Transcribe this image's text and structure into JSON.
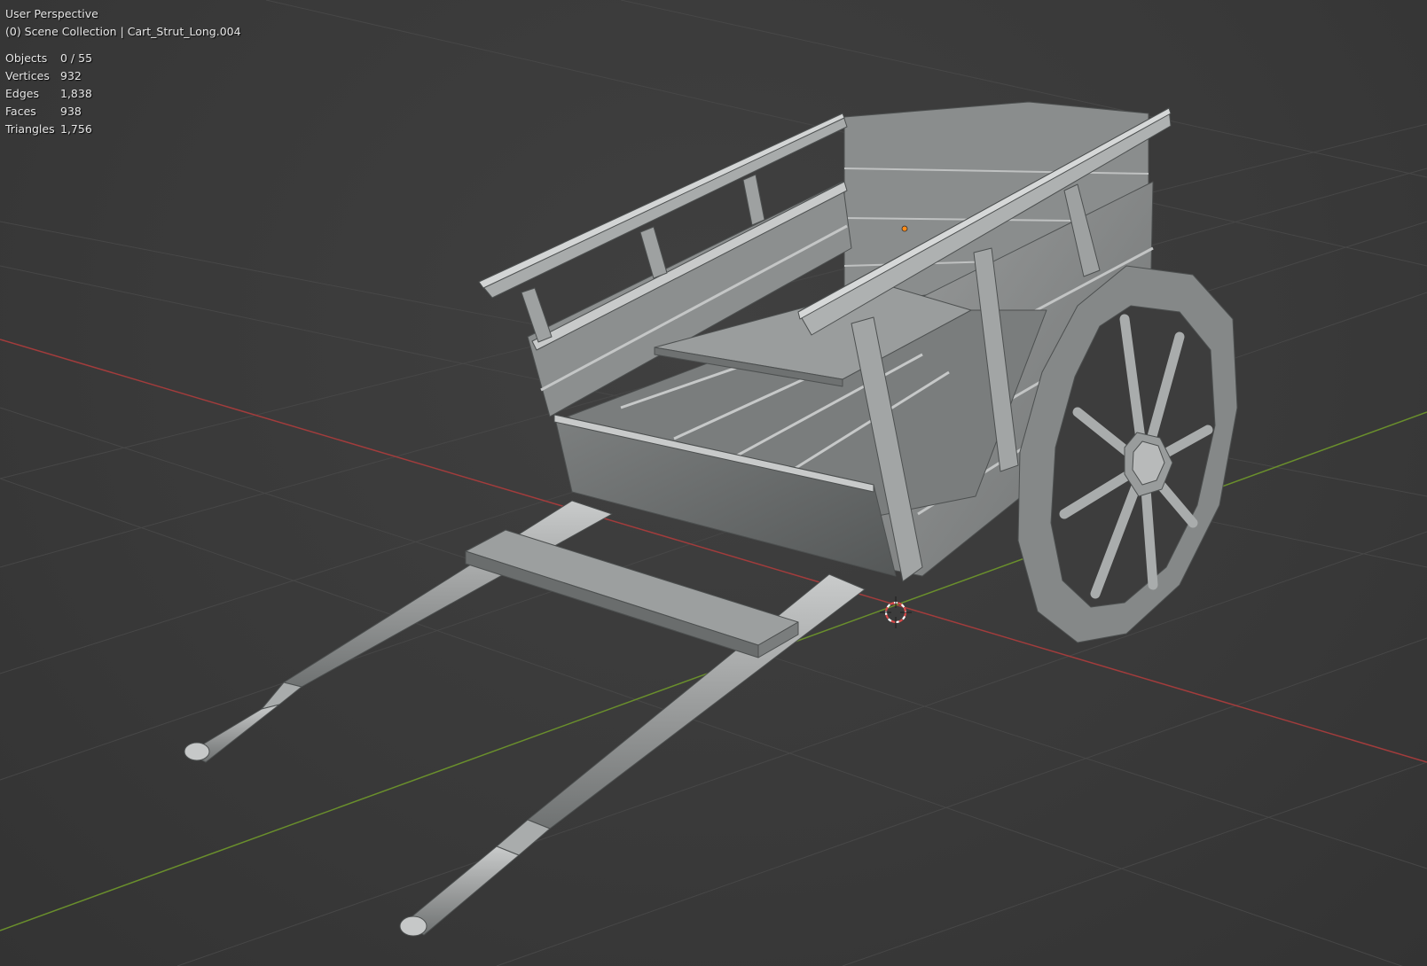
{
  "viewport": {
    "view_name": "User Perspective",
    "collection_line": "(0) Scene Collection | Cart_Strut_Long.004"
  },
  "stats": [
    {
      "label": "Objects",
      "value": "0 / 55"
    },
    {
      "label": "Vertices",
      "value": "932"
    },
    {
      "label": "Edges",
      "value": "1,838"
    },
    {
      "label": "Faces",
      "value": "938"
    },
    {
      "label": "Triangles",
      "value": "1,756"
    }
  ],
  "colors": {
    "x_axis": "#a23c3c",
    "y_axis": "#6a8f2c",
    "grid": "#474747",
    "cursor_red": "#d84a4a",
    "origin_dot": "#ff8c1a",
    "mesh_light": "#b9bbbb",
    "mesh_mid": "#8f9191",
    "mesh_dark": "#5f6262"
  },
  "icons": [
    "3d-cursor-icon",
    "object-origin-icon"
  ]
}
